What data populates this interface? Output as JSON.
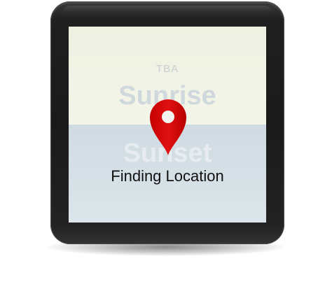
{
  "watch_face": {
    "date_label": "TBA",
    "sunrise_label": "Sunrise",
    "sunset_label": "Sunset",
    "status_text": "Finding Location"
  },
  "icons": {
    "pin": "location-pin-icon"
  },
  "colors": {
    "pin_red": "#d50000",
    "screen_top": "#eef0e2",
    "screen_bottom": "#d6e1e7",
    "bezel": "#1c1c1c"
  }
}
